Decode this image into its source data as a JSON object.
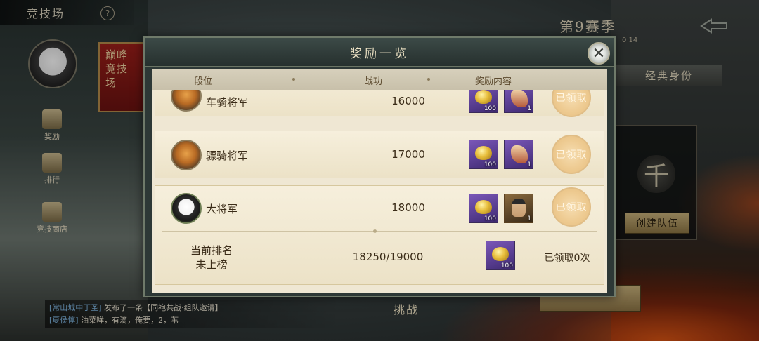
{
  "top": {
    "arena_title": "竞技场",
    "help_symbol": "?",
    "season": "第9赛季",
    "season_sub": "0 14"
  },
  "left_nav": {
    "banner_text": "巅峰竞技场",
    "items": [
      {
        "label": "奖励"
      },
      {
        "label": "排行"
      },
      {
        "label": "竞技商店"
      }
    ]
  },
  "right_panel": {
    "classic_tab": "经典身份",
    "team_symbol": "千",
    "create_team": "创建队伍"
  },
  "chat": {
    "line1_channel": "[常山城中丁圣]",
    "line1_text": "发布了一条【同袍共战·组队邀请】",
    "line2_channel": "[夏侯惇]",
    "line2_text": "油菜哞，有滴，俺要，2，苇"
  },
  "challenge_label": "挑战",
  "modal": {
    "title": "奖励一览",
    "close_symbol": "✕",
    "columns": {
      "rank": "段位",
      "power": "战功",
      "rewards": "奖励内容"
    },
    "rows": [
      {
        "rank": "车骑将军",
        "power": "16000",
        "item1_qty": "100",
        "item2_qty": "1",
        "status": "已领取",
        "icon": "tiger-icon"
      },
      {
        "rank": "骠骑将军",
        "power": "17000",
        "item1_qty": "100",
        "item2_qty": "1",
        "status": "已领取",
        "icon": "tiger-icon"
      },
      {
        "rank": "大将军",
        "power": "18000",
        "item1_qty": "100",
        "item2_qty": "1",
        "status": "已领取",
        "icon": "panda-icon"
      }
    ],
    "current": {
      "label_line1": "当前排名",
      "label_line2": "未上榜",
      "progress": "18250/19000",
      "item_qty": "100",
      "claimed_count": "已领取0次"
    }
  }
}
